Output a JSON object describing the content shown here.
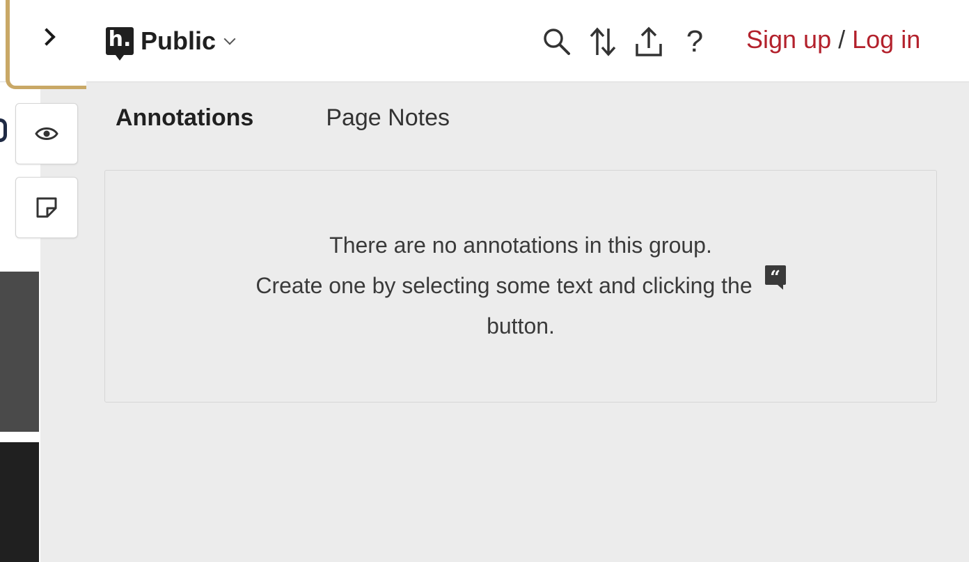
{
  "header": {
    "group_logo_letter": "h.",
    "group_name": "Public",
    "icons": [
      "search-icon",
      "sort-icon",
      "share-icon",
      "help-icon"
    ],
    "help_glyph": "?",
    "sign_up_label": "Sign up",
    "separator": " / ",
    "log_in_label": "Log in"
  },
  "sidebar_toggle": {
    "icon": "chevron-right-icon"
  },
  "rail": {
    "buttons": [
      {
        "icon": "eye-icon"
      },
      {
        "icon": "sticky-note-icon"
      }
    ]
  },
  "tabs": [
    {
      "label": "Annotations",
      "active": true
    },
    {
      "label": "Page Notes",
      "active": false
    }
  ],
  "empty_state": {
    "line1": "There are no annotations in this group.",
    "line2": "Create one by selecting some text and clicking the",
    "icon_glyph": "“",
    "line3": "button."
  },
  "colors": {
    "accent_red": "#b3212c",
    "tab_border_gold": "#c9a866",
    "panel_bg": "#ececec"
  }
}
